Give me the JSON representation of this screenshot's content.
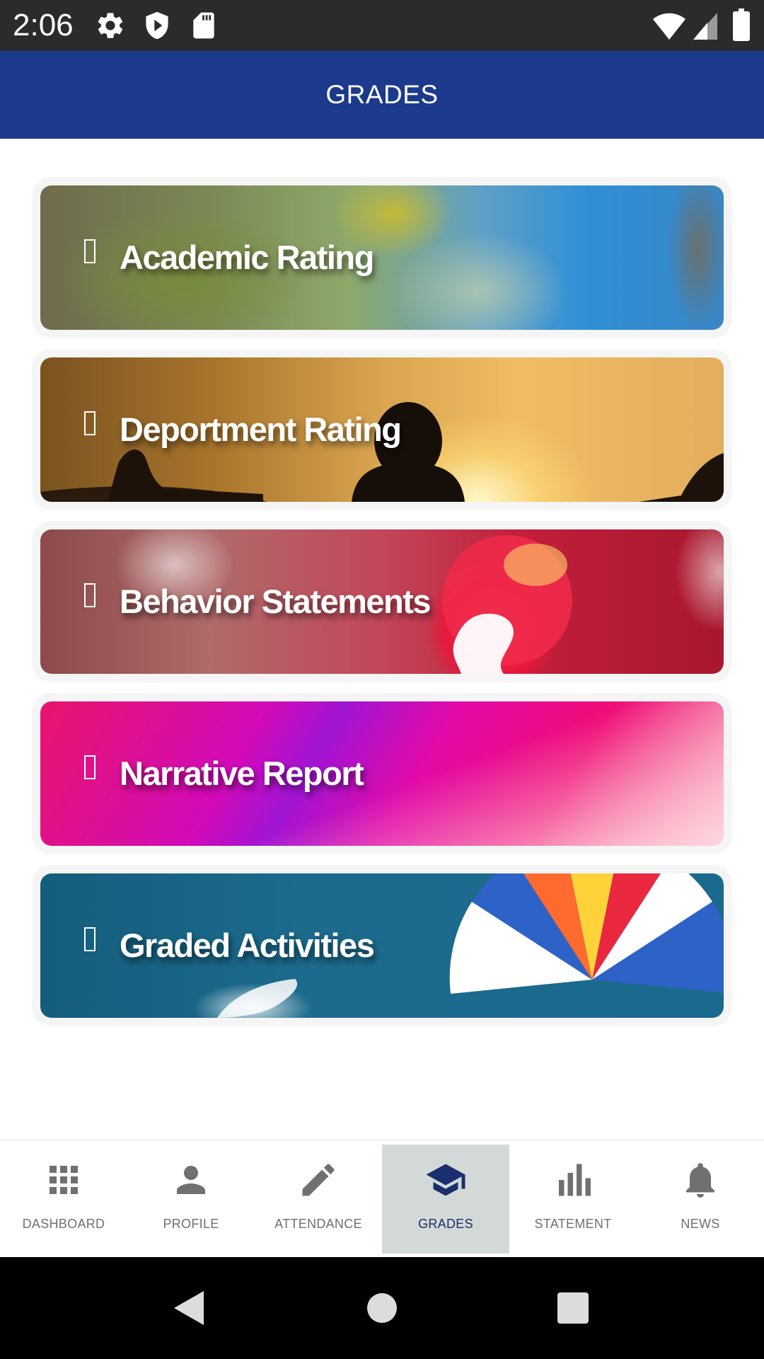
{
  "status_bar": {
    "time": "2:06",
    "icons": [
      "settings-icon",
      "shield-icon",
      "sd-card-icon",
      "wifi-icon",
      "signal-icon",
      "battery-icon"
    ]
  },
  "app_bar": {
    "title": "GRADES",
    "color": "#1b3a8c"
  },
  "cards": [
    {
      "label": "Academic Rating"
    },
    {
      "label": "Deportment Rating"
    },
    {
      "label": "Behavior Statements"
    },
    {
      "label": "Narrative Report"
    },
    {
      "label": "Graded Activities"
    }
  ],
  "bottom_nav": {
    "active": "GRADES",
    "items": [
      {
        "label": "DASHBOARD",
        "icon": "grid-icon"
      },
      {
        "label": "PROFILE",
        "icon": "person-icon"
      },
      {
        "label": "ATTENDANCE",
        "icon": "pencil-icon"
      },
      {
        "label": "GRADES",
        "icon": "graduation-cap-icon"
      },
      {
        "label": "STATEMENT",
        "icon": "bar-chart-icon"
      },
      {
        "label": "NEWS",
        "icon": "bell-icon"
      }
    ]
  },
  "system_nav": {
    "buttons": [
      "back-icon",
      "home-icon",
      "recents-icon"
    ]
  }
}
